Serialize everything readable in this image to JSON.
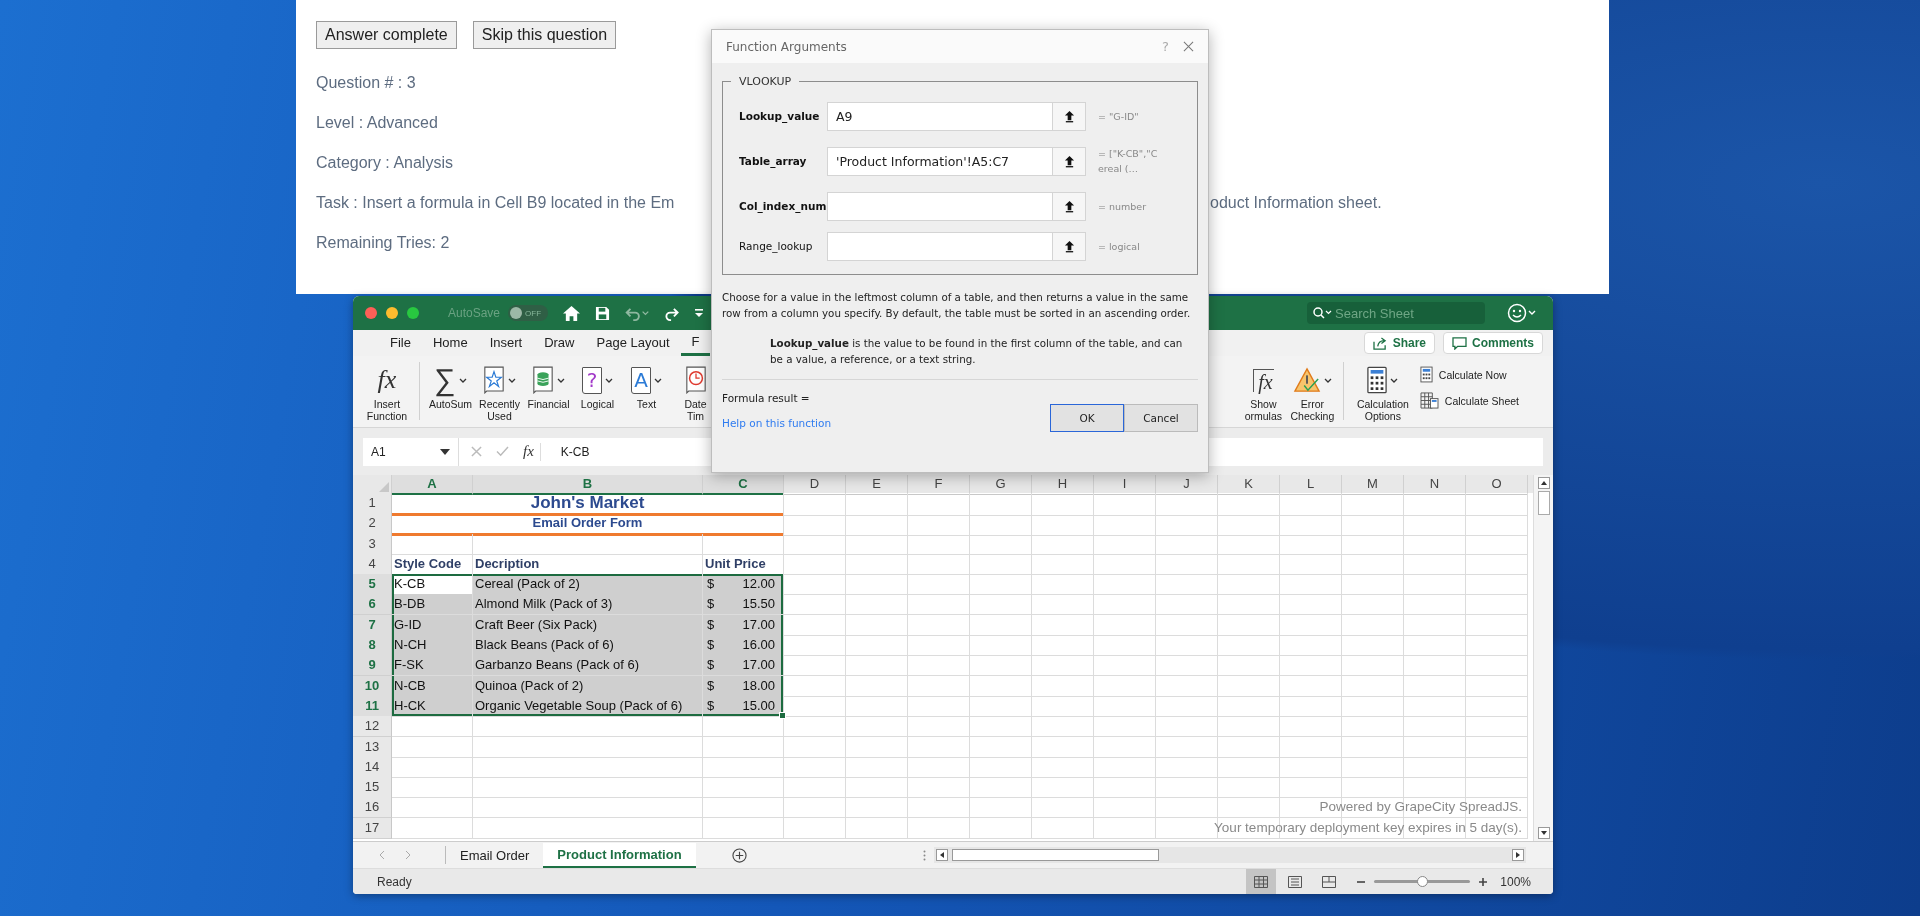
{
  "quiz": {
    "buttons": [
      {
        "label": "Answer complete"
      },
      {
        "label": "Skip this question"
      }
    ],
    "lines": [
      {
        "kind": "plain",
        "text": "Question # : 3"
      },
      {
        "kind": "plain",
        "text": "Level : Advanced"
      },
      {
        "kind": "plain",
        "text": "Category : Analysis"
      },
      {
        "kind": "split",
        "text": "Task : Insert a formula in Cell B9 located in the Em",
        "tail": "oduct Information sheet."
      },
      {
        "kind": "plain",
        "text": "Remaining Tries: 2"
      }
    ]
  },
  "excel": {
    "autosave": {
      "label": "AutoSave",
      "on": false,
      "state_text": "OFF"
    },
    "search": {
      "placeholder": "Search Sheet"
    },
    "ribbon_tabs": [
      {
        "label": "File",
        "selected": false
      },
      {
        "label": "Home",
        "selected": false
      },
      {
        "label": "Insert",
        "selected": false
      },
      {
        "label": "Draw",
        "selected": false
      },
      {
        "label": "Page Layout",
        "selected": false
      },
      {
        "label": "F",
        "selected": true
      }
    ],
    "share_button": "Share",
    "comments_button": "Comments",
    "insert_function": {
      "glyph": "fx",
      "lines": [
        "Insert",
        "Function"
      ]
    },
    "tools_left": [
      {
        "kind": "sum",
        "glyph": "∑",
        "lines": [
          "AutoSum"
        ],
        "dropdown": true
      },
      {
        "kind": "star-book",
        "lines": [
          "Recently",
          "Used"
        ],
        "dropdown": true
      },
      {
        "kind": "coins-book",
        "lines": [
          "Financial"
        ],
        "dropdown": true
      },
      {
        "kind": "logic-book",
        "glyph": "?",
        "lines": [
          "Logical"
        ],
        "dropdown": true
      },
      {
        "kind": "text-book",
        "glyph": "A",
        "lines": [
          "Text"
        ],
        "dropdown": true
      },
      {
        "kind": "clock-book",
        "lines": [
          "Date",
          "Tim"
        ],
        "dropdown": false
      }
    ],
    "tools_right": [
      {
        "kind": "show-formulas",
        "glyph": "fx",
        "lines": [
          "Show",
          "ormulas"
        ],
        "dropdown": false
      },
      {
        "kind": "warning",
        "lines": [
          "Error",
          "Checking"
        ],
        "dropdown": true
      }
    ],
    "calc_options": {
      "lines": [
        "Calculation",
        "Options"
      ]
    },
    "calc_buttons": [
      {
        "kind": "calc-now",
        "label": "Calculate Now"
      },
      {
        "kind": "calc-sheet",
        "label": "Calculate Sheet"
      }
    ],
    "name_box": "A1",
    "fx_glyph": "fx",
    "formula": "K-CB",
    "sheet": {
      "columns": [
        {
          "label": "A",
          "selected": true
        },
        {
          "label": "B",
          "selected": true
        },
        {
          "label": "C",
          "selected": true
        },
        {
          "label": "D",
          "selected": false
        },
        {
          "label": "E",
          "selected": false
        },
        {
          "label": "F",
          "selected": false
        },
        {
          "label": "G",
          "selected": false
        },
        {
          "label": "H",
          "selected": false
        },
        {
          "label": "I",
          "selected": false
        },
        {
          "label": "J",
          "selected": false
        },
        {
          "label": "K",
          "selected": false
        },
        {
          "label": "L",
          "selected": false
        },
        {
          "label": "M",
          "selected": false
        },
        {
          "label": "N",
          "selected": false
        },
        {
          "label": "O",
          "selected": false
        }
      ],
      "rows": [
        {
          "number": "1",
          "kind": "title",
          "selected": false,
          "text": "John's Market"
        },
        {
          "number": "2",
          "kind": "subtitle",
          "selected": false,
          "text": "Email Order Form"
        },
        {
          "number": "3",
          "kind": "empty",
          "selected": false
        },
        {
          "number": "4",
          "kind": "header",
          "selected": false,
          "cells": [
            "Style Code",
            "Decription",
            "Unit Price"
          ]
        },
        {
          "number": "5",
          "kind": "item",
          "selected": true,
          "active": true,
          "code": "K-CB",
          "description": "Cereal (Pack of 2)",
          "currency": "$",
          "price": "12.00"
        },
        {
          "number": "6",
          "kind": "item",
          "selected": true,
          "active": false,
          "code": "B-DB",
          "description": "Almond Milk (Pack of 3)",
          "currency": "$",
          "price": "15.50"
        },
        {
          "number": "7",
          "kind": "item",
          "selected": true,
          "active": false,
          "code": "G-ID",
          "description": "Craft Beer (Six Pack)",
          "currency": "$",
          "price": "17.00"
        },
        {
          "number": "8",
          "kind": "item",
          "selected": true,
          "active": false,
          "code": "N-CH",
          "description": "Black Beans (Pack of 6)",
          "currency": "$",
          "price": "16.00"
        },
        {
          "number": "9",
          "kind": "item",
          "selected": true,
          "active": false,
          "code": "F-SK",
          "description": "Garbanzo Beans (Pack of 6)",
          "currency": "$",
          "price": "17.00"
        },
        {
          "number": "10",
          "kind": "item",
          "selected": true,
          "active": false,
          "code": "N-CB",
          "description": "Quinoa (Pack of 2)",
          "currency": "$",
          "price": "18.00"
        },
        {
          "number": "11",
          "kind": "item",
          "selected": true,
          "active": false,
          "code": "H-CK",
          "description": "Organic Vegetable Soup (Pack of 6)",
          "currency": "$",
          "price": "15.00"
        },
        {
          "number": "12",
          "kind": "empty",
          "selected": false
        },
        {
          "number": "13",
          "kind": "empty",
          "selected": false
        },
        {
          "number": "14",
          "kind": "empty",
          "selected": false
        },
        {
          "number": "15",
          "kind": "empty",
          "selected": false
        },
        {
          "number": "16",
          "kind": "empty",
          "selected": false
        },
        {
          "number": "17",
          "kind": "empty",
          "selected": false
        }
      ],
      "notice": [
        "Powered by GrapeCity SpreadJS.",
        "Your temporary deployment key expires in 5 day(s)."
      ]
    },
    "sheet_tabs": [
      {
        "label": "Email Order",
        "selected": false
      },
      {
        "label": "Product Information",
        "selected": true
      }
    ],
    "status": "Ready",
    "zoom": {
      "level": 0.5,
      "reading": "100%"
    }
  },
  "dialog": {
    "title": "Function Arguments",
    "help_glyph": "?",
    "function": "VLOOKUP",
    "arguments": [
      {
        "label": "Lookup_value",
        "required": true,
        "value": "A9",
        "result": "= \"G-ID\""
      },
      {
        "label": "Table_array",
        "required": true,
        "value": "'Product Information'!A5:C7",
        "result": "= [\"K-CB\",\"Cereal (…"
      },
      {
        "label": "Col_index_num",
        "required": true,
        "result": "= number"
      },
      {
        "label": "Range_lookup",
        "required": false,
        "result": "= logical"
      }
    ],
    "description": "Choose for a value in the leftmost column of a table, and then returns a value in the same row from a column you specify. By default, the table must be sorted in an ascending order.",
    "argument_help": "**Lookup_value** is the value to be found in the first column of the table, and can be a value, a reference, or a text string.",
    "formula_result": "Formula result =",
    "help_link": "Help on this function",
    "buttons": [
      {
        "label": "OK",
        "default": true
      },
      {
        "label": "Cancel",
        "default": false
      }
    ]
  }
}
